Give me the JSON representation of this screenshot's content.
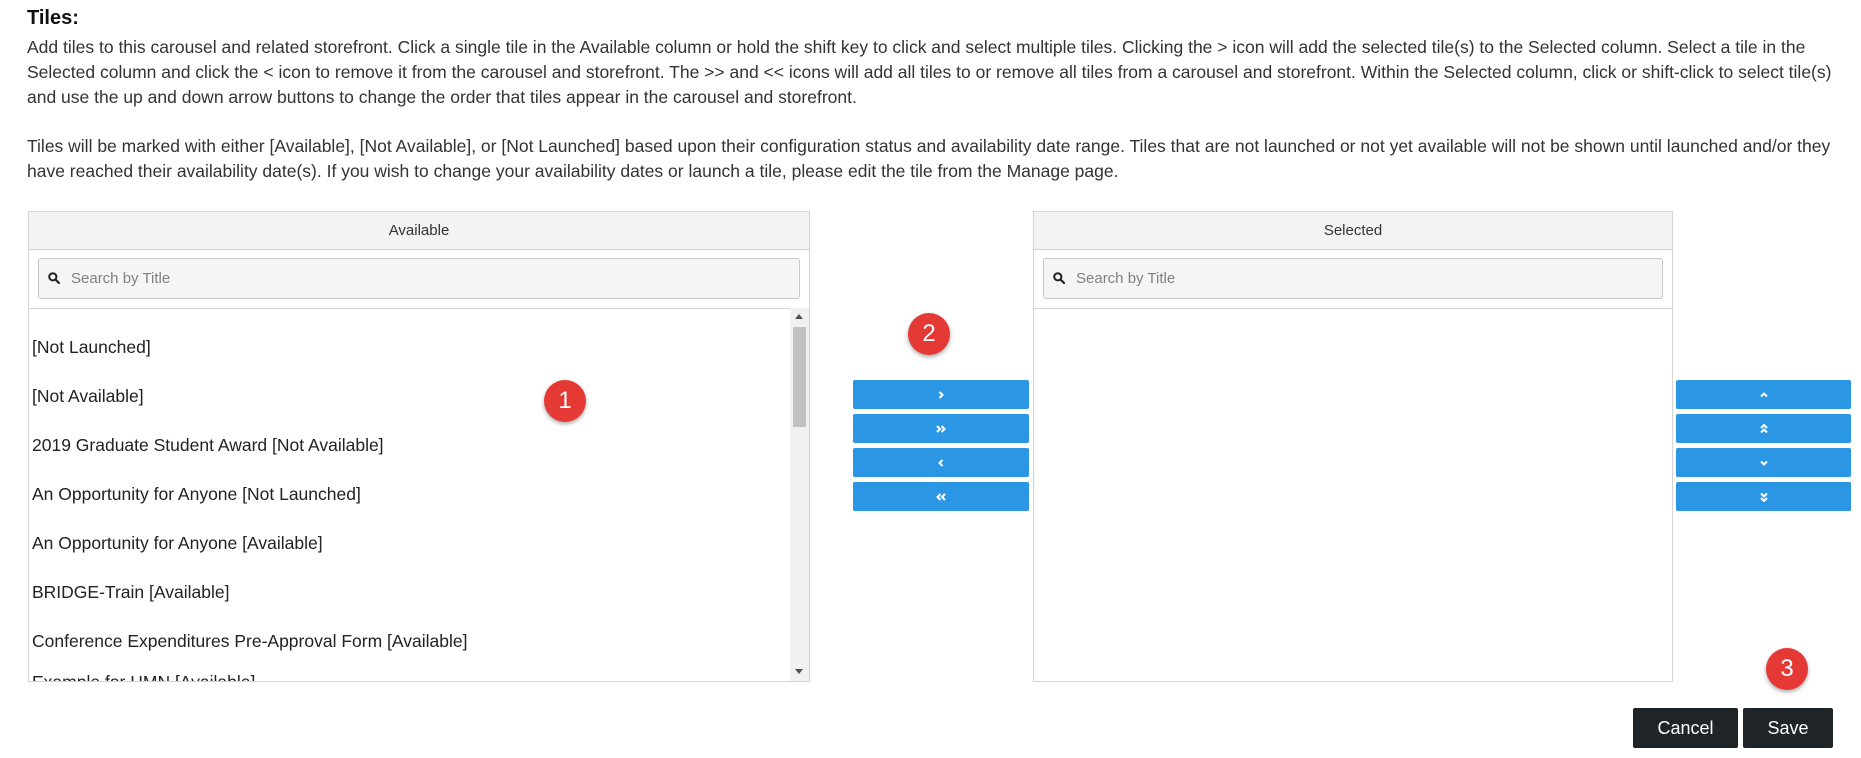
{
  "heading": "Tiles:",
  "description": {
    "p1": "Add tiles to this carousel and related storefront. Click a single tile in the Available column or hold the shift key to click and select multiple tiles. Clicking the > icon will add the selected tile(s) to the Selected column. Select a tile in the Selected column and click the < icon to remove it from the carousel and storefront. The >> and << icons will add all tiles to or remove all tiles from a carousel and storefront. Within the Selected column, click or shift-click to select tile(s) and use the up and down arrow buttons to change the order that tiles appear in the carousel and storefront.",
    "p2": "Tiles will be marked with either [Available], [Not Available], or [Not Launched] based upon their configuration status and availability date range. Tiles that are not launched or not yet available will not be shown until launched and/or they have reached their availability date(s). If you wish to change your availability dates or launch a tile, please edit the tile from the Manage page."
  },
  "available": {
    "header": "Available",
    "search_placeholder": "Search by Title",
    "items": [
      "[Not Launched]",
      "[Not Available]",
      "2019 Graduate Student Award [Not Available]",
      "An Opportunity for Anyone [Not Launched]",
      "An Opportunity for Anyone [Available]",
      "BRIDGE-Train [Available]",
      "Conference Expenditures Pre-Approval Form [Available]",
      "Example for HMN [Available]"
    ]
  },
  "selected": {
    "header": "Selected",
    "search_placeholder": "Search by Title"
  },
  "transfer_buttons": [
    {
      "name": "move-right-button",
      "icon": "chevron-right-icon"
    },
    {
      "name": "move-all-right-button",
      "icon": "double-chevron-right-icon"
    },
    {
      "name": "move-left-button",
      "icon": "chevron-left-icon"
    },
    {
      "name": "move-all-left-button",
      "icon": "double-chevron-left-icon"
    }
  ],
  "order_buttons": [
    {
      "name": "move-up-button",
      "icon": "chevron-up-icon"
    },
    {
      "name": "move-top-button",
      "icon": "double-chevron-up-icon"
    },
    {
      "name": "move-down-button",
      "icon": "chevron-down-icon"
    },
    {
      "name": "move-bottom-button",
      "icon": "double-chevron-down-icon"
    }
  ],
  "badges": [
    "1",
    "2",
    "3"
  ],
  "actions": {
    "cancel_label": "Cancel",
    "save_label": "Save"
  },
  "colors": {
    "button_blue": "#2a96e4",
    "badge_red": "#e53935",
    "action_dark": "#1f2429"
  }
}
